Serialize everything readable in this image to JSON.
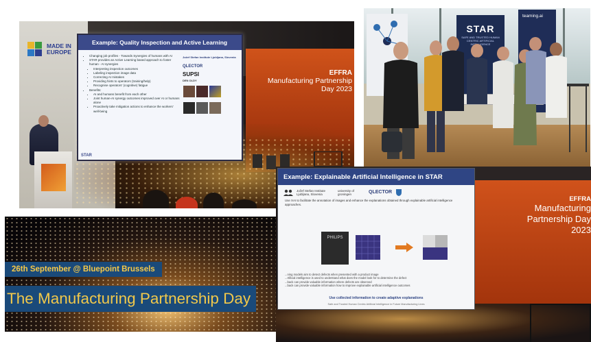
{
  "photo_stage": {
    "made_in_europe": "MADE IN EUROPE",
    "slide_title": "Example: Quality Inspection and Active Learning",
    "slide_bullets": [
      "Changing job profiles - Towards Synergies of humans with AI",
      "STAR provides an Active Learning based approach to foster human - AI synergies",
      "Interpreting inspection outcomes",
      "Labeling inspection image data",
      "Correcting AI mistakes",
      "Providing hints to operators (training/help)",
      "Recognise operators' (cognitive) fatigue",
      "Benefits:",
      "AI and humans benefit from each other",
      "Joint human-AI synergy outcomes improved over AI or humans alone",
      "Proactively take mitigation actions to enhance the workers' well-being"
    ],
    "partner_labels": [
      "Jožef Stefan Institute Ljubljana, Slovenia",
      "QLECTOR",
      "SUPSI",
      "DEN OLDY"
    ],
    "star_tag": "STAR",
    "event_org": "EFFRA",
    "event_name": "Manufacturing Partnership Day 2023"
  },
  "photo_group": {
    "rollup_title": "STAR",
    "rollup_subtitle": "SAFE AND TRUSTED HUMAN CENTRIC ARTIFICIAL INTELLIGENCE",
    "rollup_brand": "teaming.ai"
  },
  "banner": {
    "date_line": "26th September @ Bluepoint Brussels",
    "title": "The Manufacturing Partnership Day"
  },
  "photo_xai": {
    "slide_title": "Example: Explainable Artificial Intelligence in STAR",
    "logos": [
      "Jožef Stefan Institute Ljubljana, Slovenia",
      "university of groningen",
      "QLECTOR"
    ],
    "intro": "Use XAI to facilitate the annotation of images and enhance the explanations obtained through explainable artificial intelligence approaches.",
    "product_label": "PHILIPS",
    "bullets": [
      "...ning models aim to detect defects when presented with a product image",
      "...rtificial intelligence is used to understand what does the model look for to determine the defect",
      "...back can provide valuable information where defects are observed",
      "...back can provide valuable information how to improve explainable artificial intelligence outcomes"
    ],
    "use_line": "Use collected information to create adaptive explanations",
    "citation": "Safe and Trusted Human Centric Artificial Intelligence in Future Manufacturing Lines",
    "event_org": "EFFRA",
    "event_name": "Manufacturing Partnership Day 2023"
  }
}
